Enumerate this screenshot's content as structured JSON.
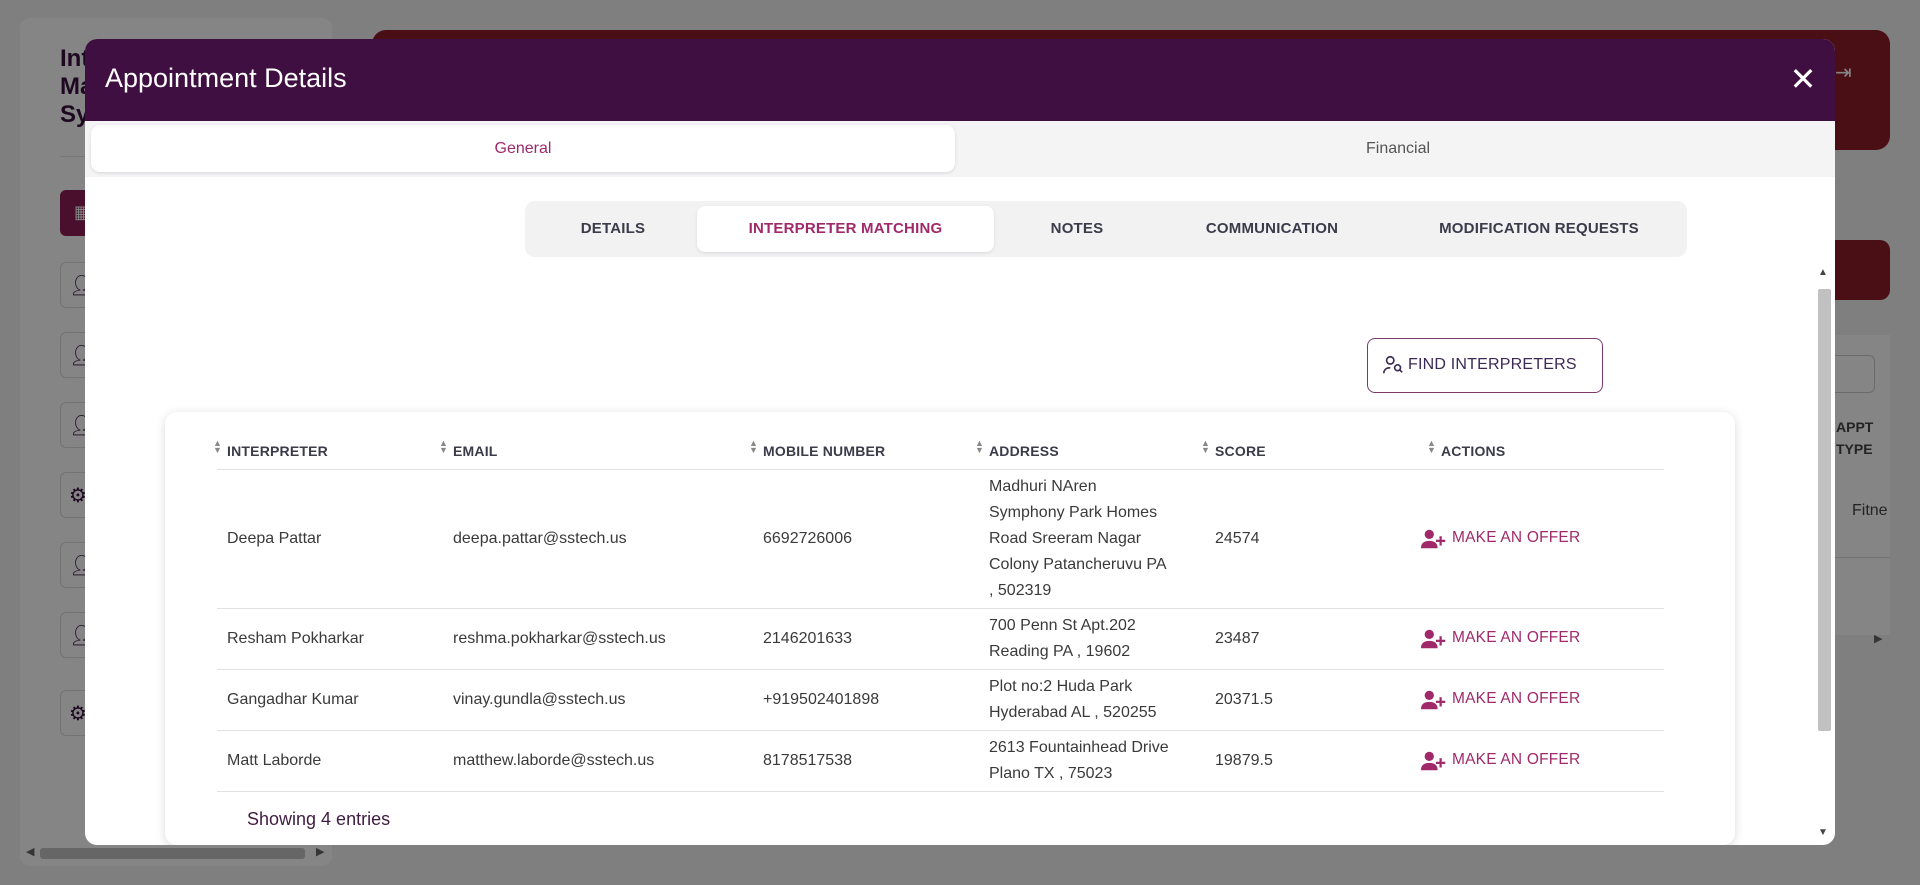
{
  "background": {
    "app_title": "Int\nMa\nSy",
    "appointment_col_header": "APPT\nTYPE",
    "appointment_cell": "Fitne"
  },
  "modal": {
    "title": "Appointment Details",
    "close_icon": "close-icon",
    "segments": [
      "General",
      "Financial"
    ],
    "active_segment": "General",
    "subtabs": [
      "DETAILS",
      "INTERPRETER MATCHING",
      "NOTES",
      "COMMUNICATION",
      "MODIFICATION REQUESTS"
    ],
    "active_subtab": "INTERPRETER MATCHING",
    "find_button": "FIND INTERPRETERS"
  },
  "table": {
    "columns": [
      "INTERPRETER",
      "EMAIL",
      "MOBILE NUMBER",
      "ADDRESS",
      "SCORE",
      "ACTIONS"
    ],
    "rows": [
      {
        "interpreter": "Deepa Pattar",
        "email": "deepa.pattar@sstech.us",
        "mobile": "6692726006",
        "address": [
          "Madhuri NAren",
          "Symphony Park Homes",
          "Road Sreeram Nagar",
          "Colony Patancheruvu PA",
          ", 502319"
        ],
        "score": "24574",
        "action": "MAKE AN OFFER"
      },
      {
        "interpreter": "Resham Pokharkar",
        "email": "reshma.pokharkar@sstech.us",
        "mobile": "2146201633",
        "address": [
          "700 Penn St Apt.202",
          "Reading PA , 19602"
        ],
        "score": "23487",
        "action": "MAKE AN OFFER"
      },
      {
        "interpreter": "Gangadhar Kumar",
        "email": "vinay.gundla@sstech.us",
        "mobile": "+919502401898",
        "address": [
          "Plot no:2 Huda Park",
          "Hyderabad AL , 520255"
        ],
        "score": "20371.5",
        "action": "MAKE AN OFFER"
      },
      {
        "interpreter": "Matt Laborde",
        "email": "matthew.laborde@sstech.us",
        "mobile": "8178517538",
        "address": [
          "2613 Fountainhead Drive",
          "Plano TX , 75023"
        ],
        "score": "19879.5",
        "action": "MAKE AN OFFER"
      }
    ],
    "footer": "Showing 4 entries"
  },
  "colors": {
    "modal_header": "#3f0f41",
    "accent": "#a0296a",
    "background_header": "#8c1d2a"
  }
}
